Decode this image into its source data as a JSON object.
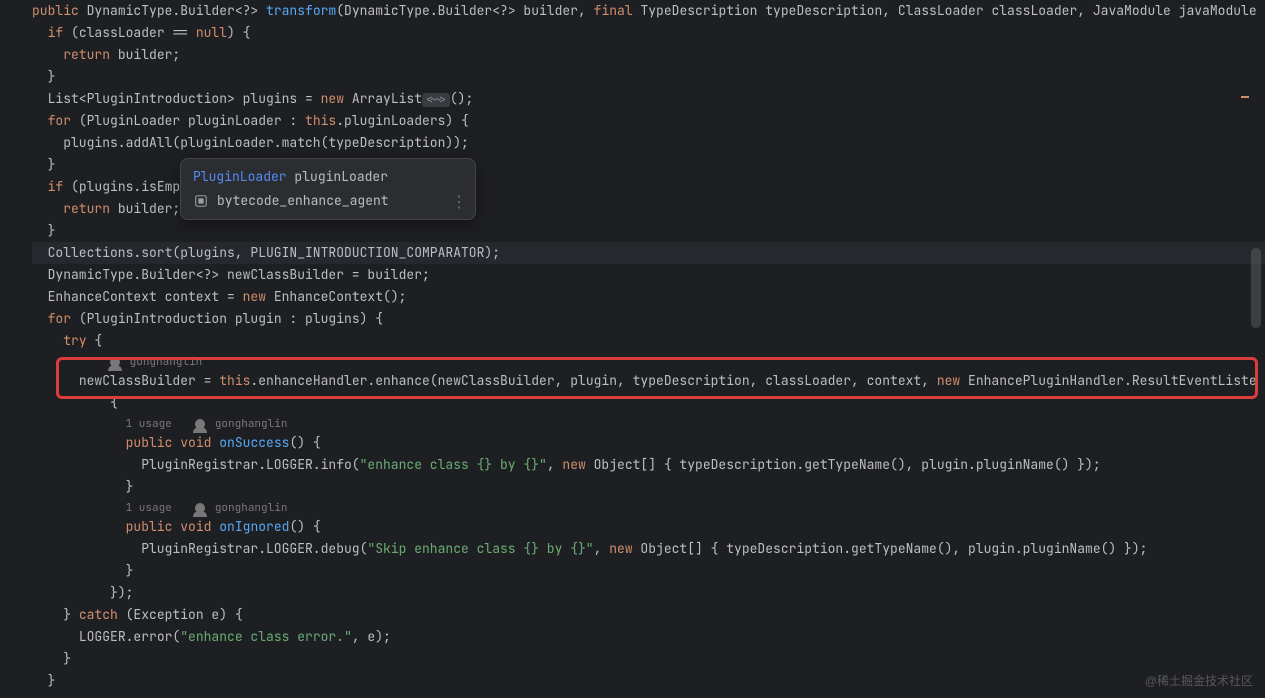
{
  "popup": {
    "item1_type": "PluginLoader",
    "item1_var": "pluginLoader",
    "item2_text": "bytecode_enhance_agent"
  },
  "inlays": {
    "author1": "gonghanglin",
    "usage1": "1 usage",
    "author2": "gonghanglin",
    "usage2": "1 usage",
    "author3": "gonghanglin"
  },
  "code": {
    "l1_public": "public",
    "l1_type": "DynamicType.Builder<?> ",
    "l1_method": "transform",
    "l1_params": "(DynamicType.Builder<?> builder, ",
    "l1_final": "final",
    "l1_rest": " TypeDescription typeDescription, ClassLoader classLoader, JavaModule javaModule",
    "l2_if": "if",
    "l2_cond": " (classLoader == ",
    "l2_null": "null",
    "l2_end": ") {",
    "l3_return": "return",
    "l3_rest": " builder;",
    "l4": "}",
    "l5_a": "List<PluginIntroduction> plugins = ",
    "l5_new": "new",
    "l5_b": " ArrayList",
    "l5_hint": "<~>",
    "l5_c": "();",
    "l6_for": "for",
    "l6_a": " (PluginLoader pluginLoader : ",
    "l6_this": "this",
    "l6_b": ".pluginLoaders) {",
    "l7": "plugins.addAll(pluginLoader.match(typeDescription));",
    "l8": "}",
    "l9_if": "if",
    "l9_rest": " (plugins.isEmp",
    "l10_return": "return",
    "l10_rest": " builder;",
    "l11": "}",
    "l12": "Collections.sort(plugins, PLUGIN_INTRODUCTION_COMPARATOR);",
    "l13": "DynamicType.Builder<?> newClassBuilder = builder;",
    "l14_a": "EnhanceContext context = ",
    "l14_new": "new",
    "l14_b": " EnhanceContext();",
    "l15_for": "for",
    "l15_rest": " (PluginIntroduction plugin : plugins) {",
    "l16_try": "try",
    "l16_rest": " {",
    "l17_a": "newClassBuilder = ",
    "l17_this": "this",
    "l17_b": ".enhanceHandler.enhance(newClassBuilder, plugin, typeDescription, classLoader, context, ",
    "l17_new": "new",
    "l17_c": " EnhancePluginHandler.ResultEventListe",
    "l18": "{",
    "l19_public": "public",
    "l19_void": "void",
    "l19_method": "onSuccess",
    "l19_rest": "() {",
    "l20_a": "PluginRegistrar.LOGGER.info(",
    "l20_str": "\"enhance class {} by {}\"",
    "l20_b": ", ",
    "l20_new": "new",
    "l20_c": " Object[] { typeDescription.getTypeName(), plugin.pluginName() });",
    "l21": "}",
    "l22_public": "public",
    "l22_void": "void",
    "l22_method": "onIgnored",
    "l22_rest": "() {",
    "l23_a": "PluginRegistrar.LOGGER.debug(",
    "l23_str": "\"Skip enhance class {} by {}\"",
    "l23_b": ", ",
    "l23_new": "new",
    "l23_c": " Object[] { typeDescription.getTypeName(), plugin.pluginName() });",
    "l24": "}",
    "l25": "});",
    "l26_a": "} ",
    "l26_catch": "catch",
    "l26_b": " (Exception e) {",
    "l27_a": "LOGGER.error(",
    "l27_str": "\"enhance class error.\"",
    "l27_b": ", e);",
    "l28": "}",
    "l29": "}"
  },
  "watermark": "@稀土掘金技术社区"
}
